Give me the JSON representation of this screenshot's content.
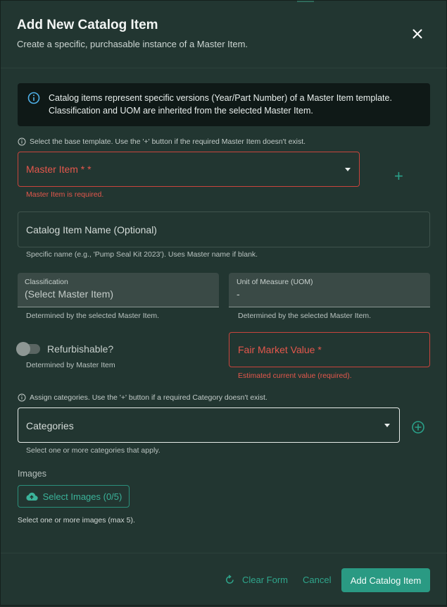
{
  "dialog": {
    "title": "Add New Catalog Item",
    "subtitle": "Create a specific, purchasable instance of a Master Item."
  },
  "info_banner": {
    "text": "Catalog items represent specific versions (Year/Part Number) of a Master Item template. Classification and UOM are inherited from the selected Master Item."
  },
  "master_item": {
    "hint": "Select the base template. Use the '+' button if the required Master Item doesn't exist.",
    "label": "Master Item * *",
    "error": "Master Item is required."
  },
  "catalog_name": {
    "label": "Catalog Item Name (Optional)",
    "helper": "Specific name (e.g., 'Pump Seal Kit 2023'). Uses Master name if blank."
  },
  "classification": {
    "label": "Classification",
    "value": "(Select Master Item)",
    "helper": "Determined by the selected Master Item."
  },
  "uom": {
    "label": "Unit of Measure (UOM)",
    "value": "-",
    "helper": "Determined by the selected Master Item."
  },
  "refurbishable": {
    "label": "Refurbishable?",
    "helper": "Determined by Master Item",
    "checked": false
  },
  "fair_market_value": {
    "label": "Fair Market Value *",
    "helper": "Estimated current value (required)."
  },
  "categories": {
    "hint": "Assign categories. Use the '+' button if a required Category doesn't exist.",
    "label": "Categories",
    "helper": "Select one or more categories that apply."
  },
  "images": {
    "section_label": "Images",
    "button_label": "Select Images (0/5)",
    "helper": "Select one or more images (max 5)."
  },
  "footer": {
    "clear_label": "Clear Form",
    "cancel_label": "Cancel",
    "submit_label": "Add Catalog Item"
  },
  "colors": {
    "accent": "#2a9a83",
    "error": "#e4574c",
    "background": "#223631"
  }
}
